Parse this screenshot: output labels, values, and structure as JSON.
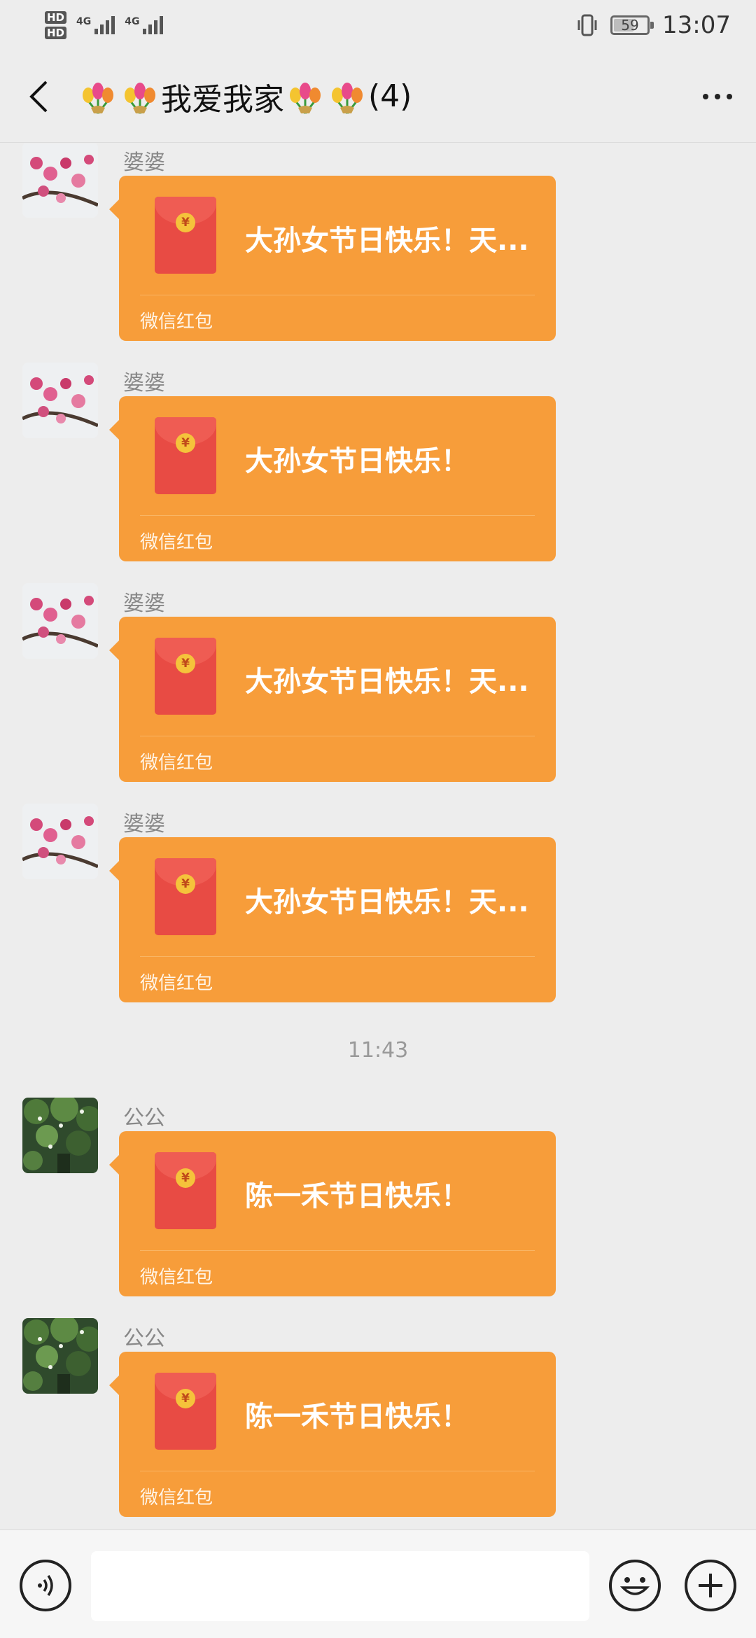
{
  "status_bar": {
    "sim1_label": "HD",
    "sim2_label": "HD",
    "net1": "4G",
    "net2": "4G",
    "battery_level": "59",
    "time": "13:07"
  },
  "header": {
    "title_text": "我爱我家",
    "member_count": "(4)"
  },
  "messages": [
    {
      "sender": "婆婆",
      "avatar": "blossom-avatar",
      "title": "大孙女节日快乐！天...",
      "footer": "微信红包"
    },
    {
      "sender": "婆婆",
      "avatar": "blossom-avatar",
      "title": "大孙女节日快乐！",
      "footer": "微信红包"
    },
    {
      "sender": "婆婆",
      "avatar": "blossom-avatar",
      "title": "大孙女节日快乐！天...",
      "footer": "微信红包"
    },
    {
      "sender": "婆婆",
      "avatar": "blossom-avatar",
      "title": "大孙女节日快乐！天...",
      "footer": "微信红包"
    },
    {
      "sender": "公公",
      "avatar": "tree-avatar",
      "title": "陈一禾节日快乐！",
      "footer": "微信红包"
    },
    {
      "sender": "公公",
      "avatar": "tree-avatar",
      "title": "陈一禾节日快乐！",
      "footer": "微信红包"
    }
  ],
  "time_separator": "11:43",
  "input": {
    "placeholder": ""
  },
  "colors": {
    "packet": "#f79d3a",
    "envelope": "#e84b44",
    "background": "#ededed"
  },
  "icons": [
    "back-arrow-icon",
    "tulip-icon",
    "more-icon",
    "voice-icon",
    "emoji-icon",
    "plus-icon",
    "yuan-coin-icon"
  ]
}
